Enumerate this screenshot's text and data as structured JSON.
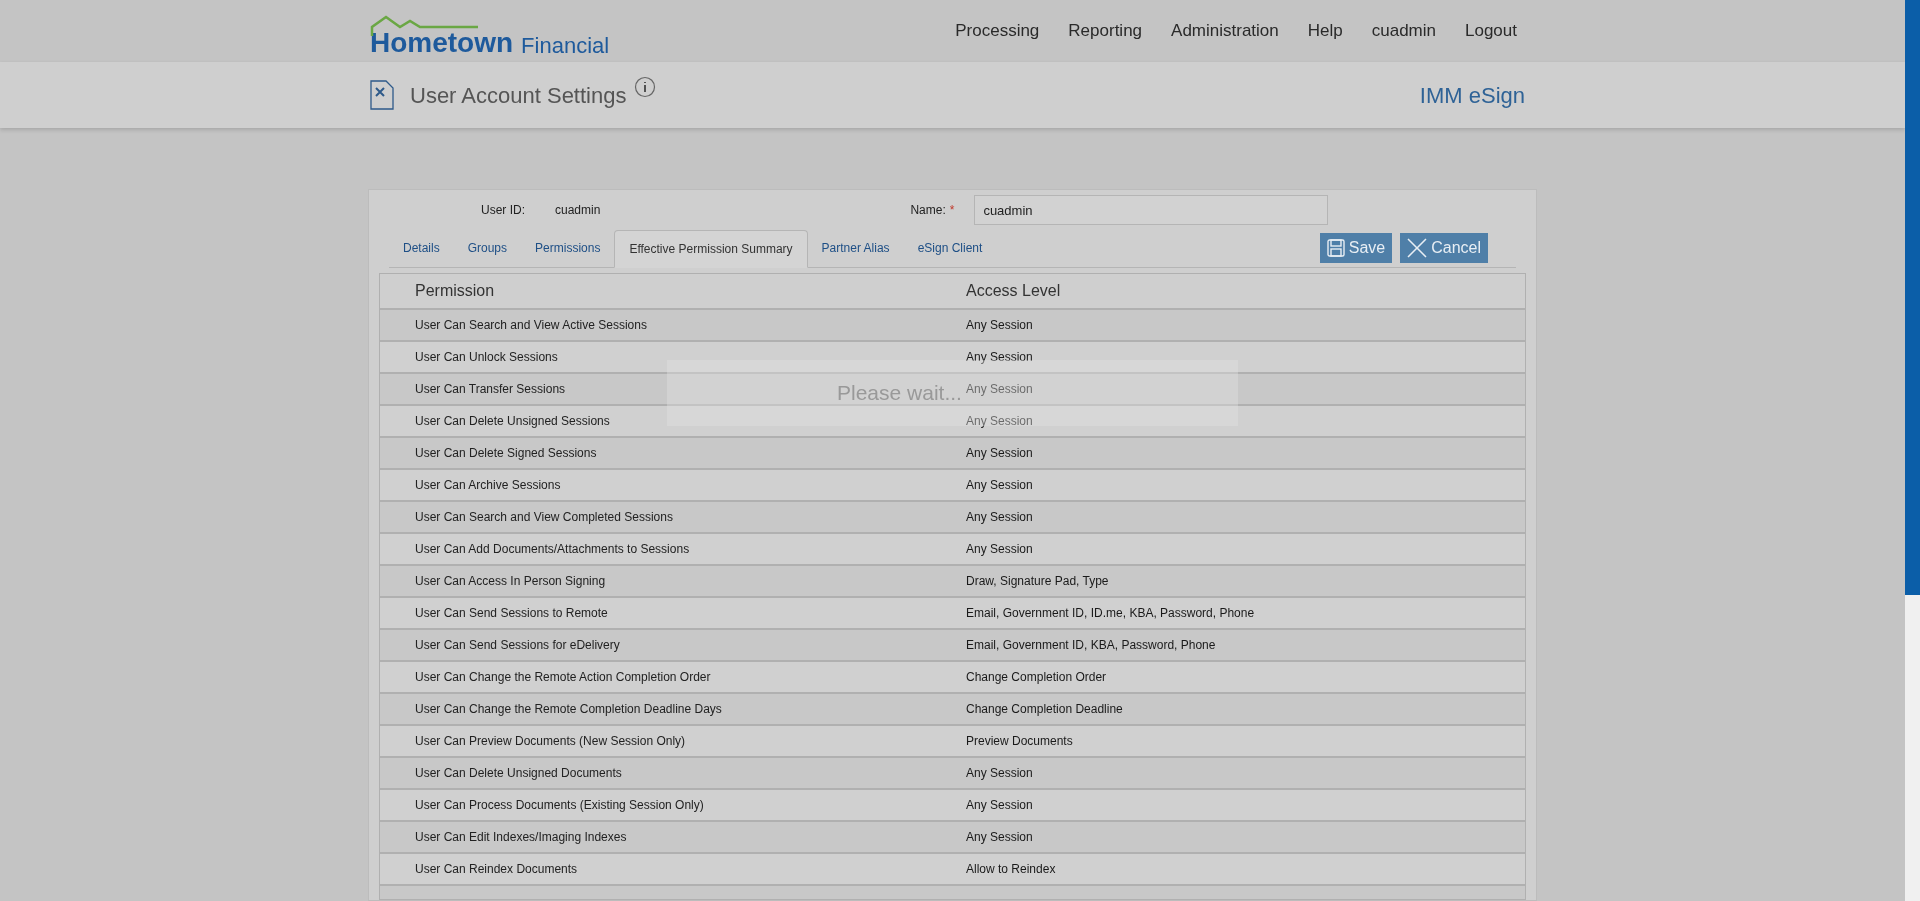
{
  "brand": {
    "name_bold": "Hometown",
    "name_light": "Financial"
  },
  "nav": [
    "Processing",
    "Reporting",
    "Administration",
    "Help",
    "cuadmin",
    "Logout"
  ],
  "page": {
    "title": "User Account Settings",
    "product": "IMM eSign"
  },
  "form": {
    "user_id_label": "User ID:",
    "user_id": "cuadmin",
    "name_label": "Name:",
    "required_mark": "*",
    "name_value": "cuadmin"
  },
  "tabs": [
    {
      "label": "Details",
      "selected": false
    },
    {
      "label": "Groups",
      "selected": false
    },
    {
      "label": "Permissions",
      "selected": false
    },
    {
      "label": "Effective Permission Summary",
      "selected": true
    },
    {
      "label": "Partner Alias",
      "selected": false
    },
    {
      "label": "eSign Client",
      "selected": false
    }
  ],
  "buttons": [
    {
      "label": "Save",
      "kind": "save"
    },
    {
      "label": "Cancel",
      "kind": "cancel"
    }
  ],
  "table": {
    "columns": [
      "Permission",
      "Access Level"
    ],
    "rows": [
      [
        "User Can Search and View Active Sessions",
        "Any Session"
      ],
      [
        "User Can Unlock Sessions",
        "Any Session"
      ],
      [
        "User Can Transfer Sessions",
        "Any Session"
      ],
      [
        "User Can Delete Unsigned Sessions",
        "Any Session"
      ],
      [
        "User Can Delete Signed Sessions",
        "Any Session"
      ],
      [
        "User Can Archive Sessions",
        "Any Session"
      ],
      [
        "User Can Search and View Completed Sessions",
        "Any Session"
      ],
      [
        "User Can Add Documents/Attachments to Sessions",
        "Any Session"
      ],
      [
        "User Can Access In Person Signing",
        "Draw, Signature Pad, Type"
      ],
      [
        "User Can Send Sessions to Remote",
        "Email, Government ID, ID.me, KBA, Password, Phone"
      ],
      [
        "User Can Send Sessions for eDelivery",
        "Email, Government ID, KBA, Password, Phone"
      ],
      [
        "User Can Change the Remote Action Completion Order",
        "Change Completion Order"
      ],
      [
        "User Can Change the Remote Completion Deadline Days",
        "Change Completion Deadline"
      ],
      [
        "User Can Preview Documents (New Session Only)",
        "Preview Documents"
      ],
      [
        "User Can Delete Unsigned Documents",
        "Any Session"
      ],
      [
        "User Can Process Documents (Existing Session Only)",
        "Any Session"
      ],
      [
        "User Can Edit Indexes/Imaging Indexes",
        "Any Session"
      ],
      [
        "User Can Reindex Documents",
        "Allow to Reindex"
      ]
    ]
  },
  "overlay": {
    "message": "Please wait..."
  }
}
